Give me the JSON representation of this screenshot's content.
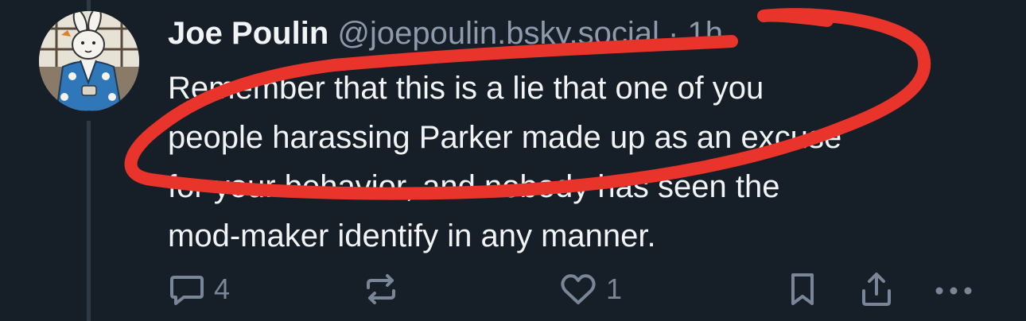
{
  "author": {
    "display_name": "Joe Poulin",
    "handle": "@joepoulin.bsky.social",
    "separator": "·",
    "timestamp": "1h"
  },
  "post": {
    "lines": [
      "Remember that this is a lie that one of you",
      "people harassing Parker made up as an excuse",
      "for your behavior, and nobody has seen the",
      "mod-maker identify in any manner."
    ]
  },
  "actions": {
    "reply_count": "4",
    "like_count": "1"
  },
  "icons": {
    "reply": "reply-bubble-icon",
    "repost": "repost-icon",
    "like": "heart-icon",
    "bookmark": "bookmark-icon",
    "share": "share-icon",
    "more": "ellipsis-icon"
  },
  "colors": {
    "background": "#161e27",
    "text": "#f1f3f5",
    "muted": "#8d9aab",
    "icon": "#788697",
    "annotation": "#e8342b"
  }
}
